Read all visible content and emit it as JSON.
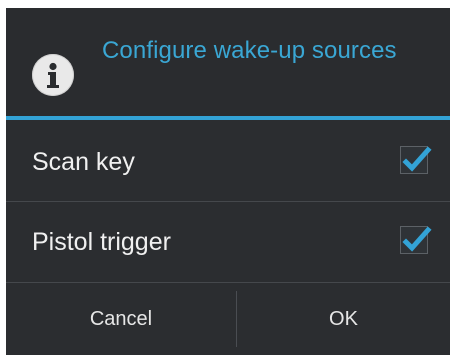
{
  "dialog": {
    "title": "Configure wake-up sources",
    "icon": "info-icon",
    "accent_color": "#33a3d6",
    "options": [
      {
        "label": "Scan key",
        "checked": true
      },
      {
        "label": "Pistol trigger",
        "checked": true
      }
    ],
    "buttons": {
      "cancel_label": "Cancel",
      "ok_label": "OK"
    }
  }
}
